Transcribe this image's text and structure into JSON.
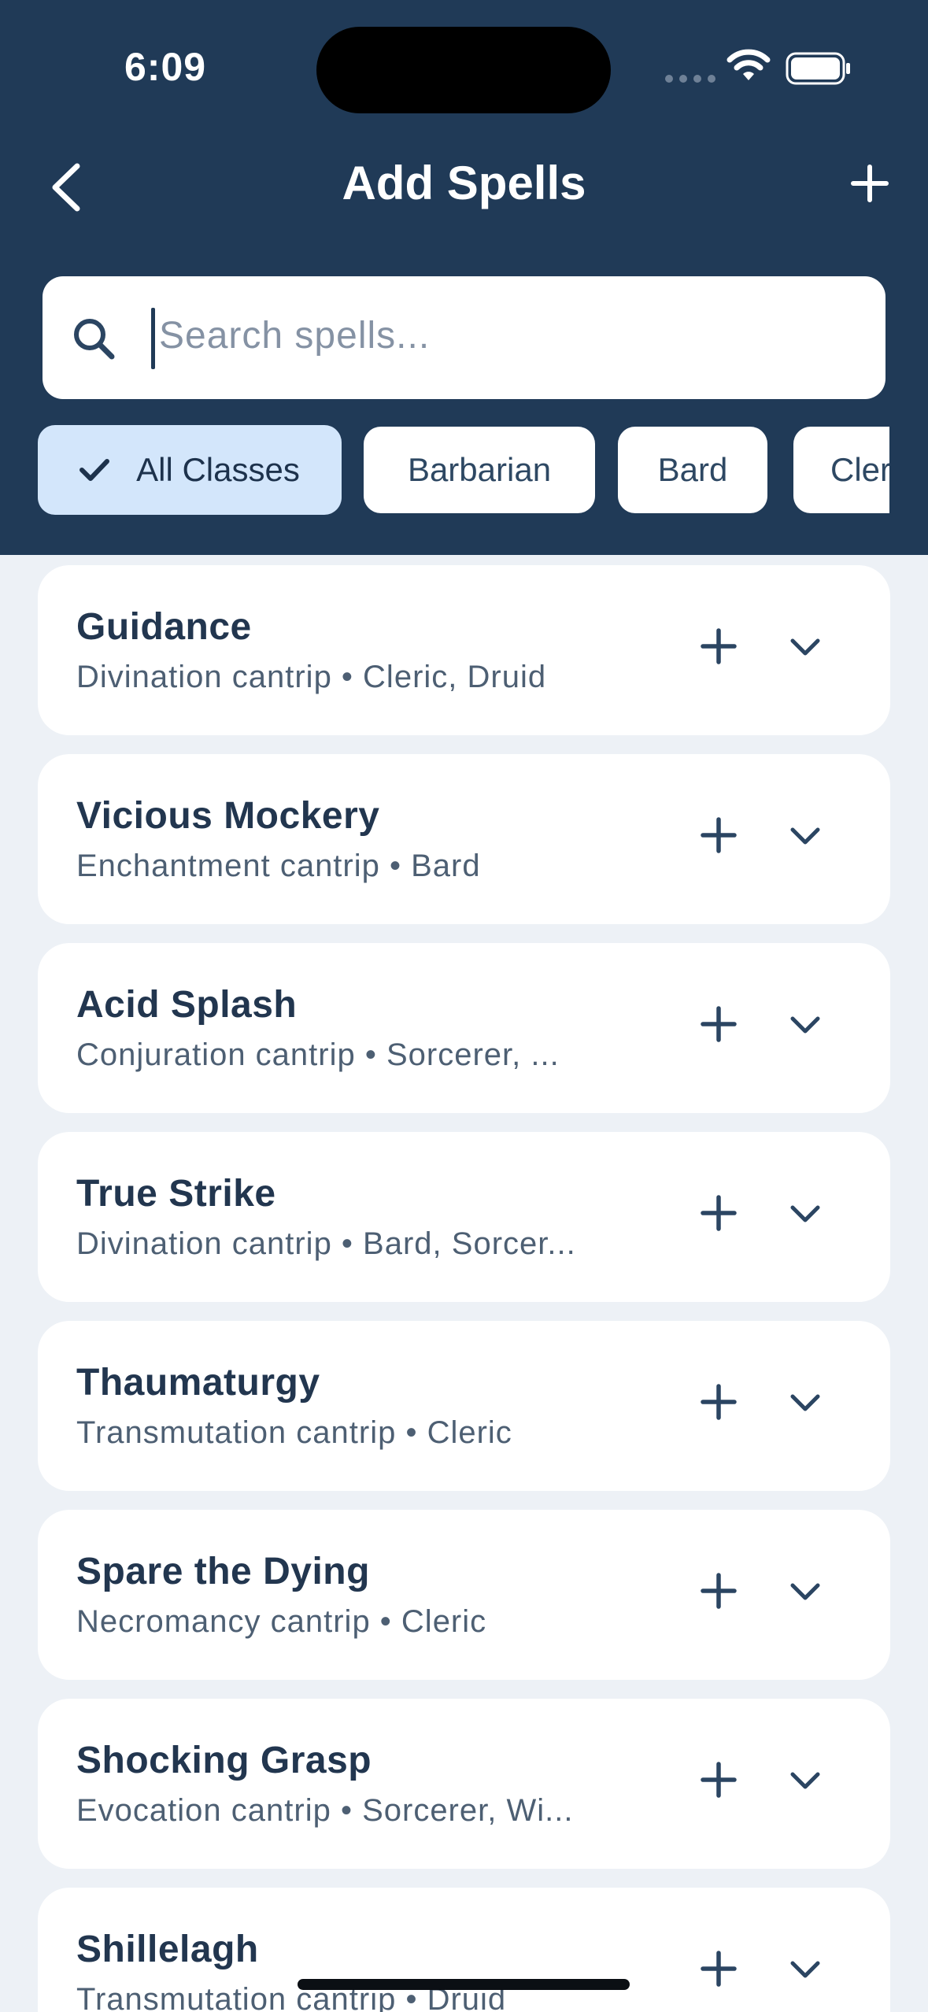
{
  "status_bar": {
    "time": "6:09"
  },
  "nav": {
    "title": "Add Spells"
  },
  "search": {
    "placeholder": "Search spells..."
  },
  "chips": [
    "All Classes",
    "Barbarian",
    "Bard",
    "Cleric"
  ],
  "active_chip": "All Classes",
  "spells": [
    {
      "name": "Guidance",
      "meta": "Divination cantrip • Cleric, Druid"
    },
    {
      "name": "Vicious Mockery",
      "meta": "Enchantment cantrip • Bard"
    },
    {
      "name": "Acid Splash",
      "meta": "Conjuration cantrip • Sorcerer, ..."
    },
    {
      "name": "True Strike",
      "meta": "Divination cantrip • Bard, Sorcer..."
    },
    {
      "name": "Thaumaturgy",
      "meta": "Transmutation cantrip • Cleric"
    },
    {
      "name": "Spare the Dying",
      "meta": "Necromancy cantrip • Cleric"
    },
    {
      "name": "Shocking Grasp",
      "meta": "Evocation cantrip • Sorcerer, Wi..."
    },
    {
      "name": "Shillelagh",
      "meta": "Transmutation cantrip • Druid"
    }
  ],
  "colors": {
    "header_bg": "#203a57",
    "page_bg": "#edf1f6",
    "chip_active_bg": "#d3e6fb",
    "text_primary": "#22364f",
    "text_secondary": "#4d5f73"
  },
  "icons": {
    "back": "chevron-left-icon",
    "add": "plus-icon",
    "search": "search-icon",
    "expand": "chevron-down-icon",
    "check": "check-icon"
  }
}
